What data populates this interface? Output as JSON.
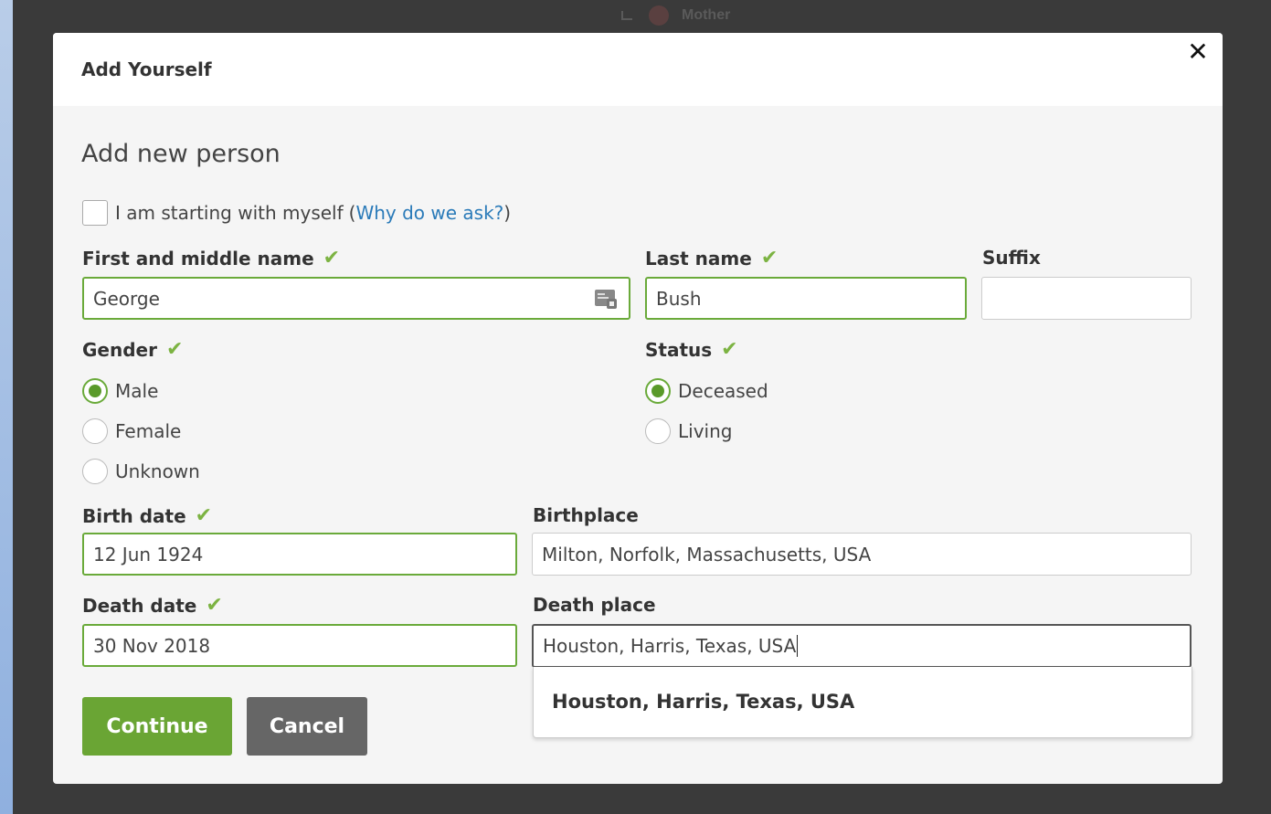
{
  "background": {
    "tree_label": "Mother"
  },
  "modal": {
    "title": "Add Yourself",
    "section_title": "Add new person",
    "myself_checkbox": {
      "label": "I am starting with myself",
      "link_text": "Why do we ask?",
      "checked": false
    },
    "first_name": {
      "label": "First and middle name",
      "value": "George"
    },
    "last_name": {
      "label": "Last name",
      "value": "Bush"
    },
    "suffix": {
      "label": "Suffix",
      "value": ""
    },
    "gender": {
      "label": "Gender",
      "options": [
        "Male",
        "Female",
        "Unknown"
      ],
      "selected": "Male"
    },
    "status": {
      "label": "Status",
      "options": [
        "Deceased",
        "Living"
      ],
      "selected": "Deceased"
    },
    "birth_date": {
      "label": "Birth date",
      "value": "12 Jun 1924"
    },
    "birthplace": {
      "label": "Birthplace",
      "value": "Milton, Norfolk, Massachusetts, USA"
    },
    "death_date": {
      "label": "Death date",
      "value": "30 Nov 2018"
    },
    "death_place": {
      "label": "Death place",
      "value": "Houston, Harris, Texas, USA",
      "suggestion": "Houston, Harris, Texas, USA"
    },
    "buttons": {
      "continue": "Continue",
      "cancel": "Cancel"
    }
  },
  "colors": {
    "accent_green": "#6aa534",
    "link_blue": "#2b7bb9",
    "cancel_gray": "#666666"
  },
  "icons": {
    "close": "close-icon",
    "check": "checkmark-icon",
    "contact_card": "contact-card-icon"
  }
}
